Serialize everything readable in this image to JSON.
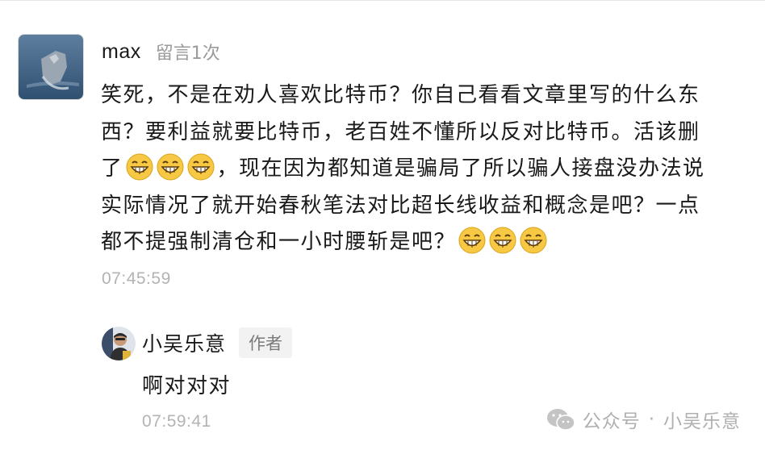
{
  "comment": {
    "username": "max",
    "comment_count": "留言1次",
    "lines": [
      "笑死，不是在劝人喜欢比特币？你自己看看文章里写的什么东",
      "西？要利益就要比特币，老百姓不懂所以反对比特币。活该删",
      "了",
      "，现在因为都知道是骗局了所以骗人接盘没办法说",
      "实际情况了就开始春秋笔法对比超长线收益和概念是吧？一点",
      "都不提强制清仓和一小时腰斩是吧？"
    ],
    "emoji": "grinning-face-icon",
    "time": "07:45:59"
  },
  "reply": {
    "username": "小吴乐意",
    "badge": "作者",
    "text": "啊对对对",
    "time": "07:59:41"
  },
  "watermark": {
    "prefix": "公众号",
    "separator": "·",
    "account": "小吴乐意"
  },
  "colors": {
    "text": "#1a1a1a",
    "muted": "#b3b3b3",
    "badge_bg": "#f2f2f2",
    "emoji_yellow": "#f7c843"
  }
}
